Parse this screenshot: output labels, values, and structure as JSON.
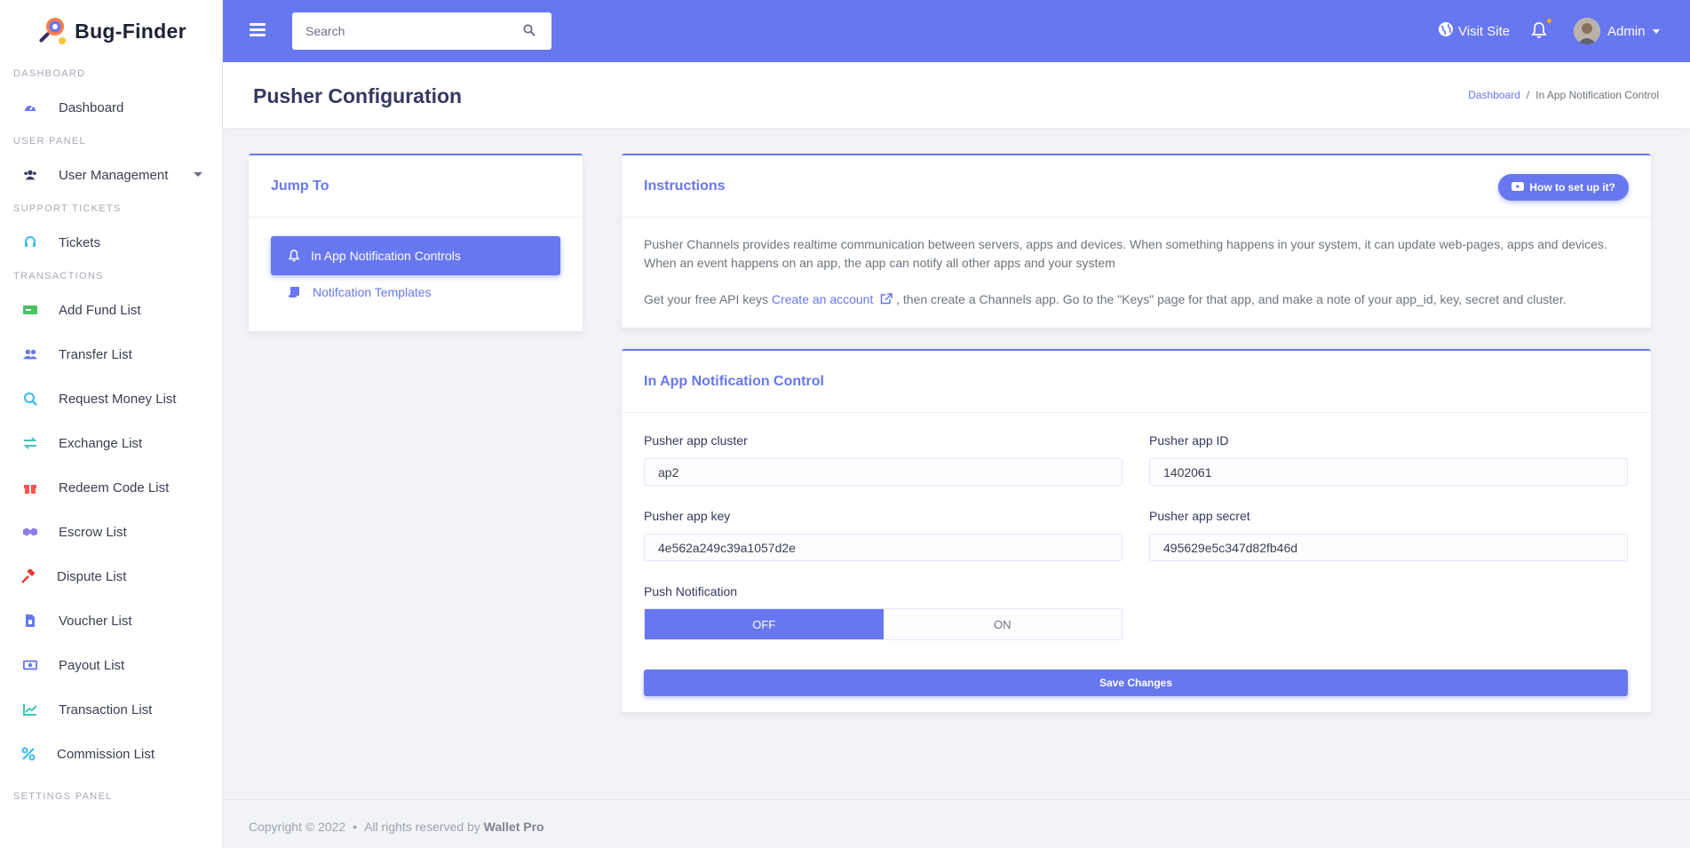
{
  "brand": {
    "name": "Bug-Finder"
  },
  "sidebar": {
    "sections": [
      {
        "title": "DASHBOARD",
        "items": [
          {
            "label": "Dashboard",
            "icon": "gauge-icon",
            "color": "#6777ef"
          }
        ]
      },
      {
        "title": "USER PANEL",
        "items": [
          {
            "label": "User Management",
            "icon": "users-icon",
            "color": "#34395e"
          }
        ]
      },
      {
        "title": "SUPPORT TICKETS",
        "items": [
          {
            "label": "Tickets",
            "icon": "headset-icon",
            "color": "#3abaf4"
          }
        ]
      },
      {
        "title": "TRANSACTIONS",
        "items": [
          {
            "label": "Add Fund List",
            "icon": "money-check-icon",
            "color": "#47c363"
          },
          {
            "label": "Transfer List",
            "icon": "user-transfer-icon",
            "color": "#6777ef"
          },
          {
            "label": "Request Money List",
            "icon": "search-dollar-icon",
            "color": "#3abaf4"
          },
          {
            "label": "Exchange List",
            "icon": "exchange-icon",
            "color": "#47c3b9"
          },
          {
            "label": "Redeem Code List",
            "icon": "gift-icon",
            "color": "#fc544b"
          },
          {
            "label": "Escrow List",
            "icon": "handshake-icon",
            "color": "#8e7cf0"
          },
          {
            "label": "Dispute List",
            "icon": "gavel-icon",
            "color": "#e53935"
          },
          {
            "label": "Voucher List",
            "icon": "voucher-icon",
            "color": "#6777ef"
          },
          {
            "label": "Payout List",
            "icon": "money-bill-icon",
            "color": "#6777ef"
          },
          {
            "label": "Transaction List",
            "icon": "chart-line-icon",
            "color": "#47c3b9"
          },
          {
            "label": "Commission List",
            "icon": "percent-icon",
            "color": "#3abaf4"
          }
        ]
      },
      {
        "title": "SETTINGS PANEL",
        "items": []
      }
    ]
  },
  "topbar": {
    "search_placeholder": "Search",
    "visit_site_label": "Visit Site",
    "admin_label": "Admin"
  },
  "header": {
    "title": "Pusher Configuration",
    "breadcrumb": {
      "home": "Dashboard",
      "separator": "/",
      "current": "In App Notification Control"
    }
  },
  "jump_to": {
    "title": "Jump To",
    "active_item": "In App Notification Controls",
    "link_item": "Notifcation Templates"
  },
  "instructions": {
    "title": "Instructions",
    "button_label": "How to set up it?",
    "paragraph1": "Pusher Channels provides realtime communication between servers, apps and devices. When something happens in your system, it can update web-pages, apps and devices. When an event happens on an app, the app can notify all other apps and your system",
    "paragraph2_prefix": "Get your free API keys",
    "paragraph2_link": "Create an account",
    "paragraph2_suffix": ", then create a Channels app. Go to the \"Keys\" page for that app, and make a note of your app_id, key, secret and cluster."
  },
  "control": {
    "title": "In App Notification Control",
    "cluster_label": "Pusher app cluster",
    "cluster_value": "ap2",
    "app_id_label": "Pusher app ID",
    "app_id_value": "1402061",
    "key_label": "Pusher app key",
    "key_value": "4e562a249c39a1057d2e",
    "secret_label": "Pusher app secret",
    "secret_value": "495629e5c347d82fb46d",
    "push_label": "Push Notification",
    "off_label": "OFF",
    "on_label": "ON",
    "selected": "OFF",
    "save_label": "Save Changes"
  },
  "footer": {
    "copyright": "Copyright © 2022",
    "bullet": "•",
    "rights": "All rights reserved by",
    "company": "Wallet Pro"
  },
  "colors": {
    "primary": "#6777ef",
    "notification_dot": "#ffa426"
  }
}
